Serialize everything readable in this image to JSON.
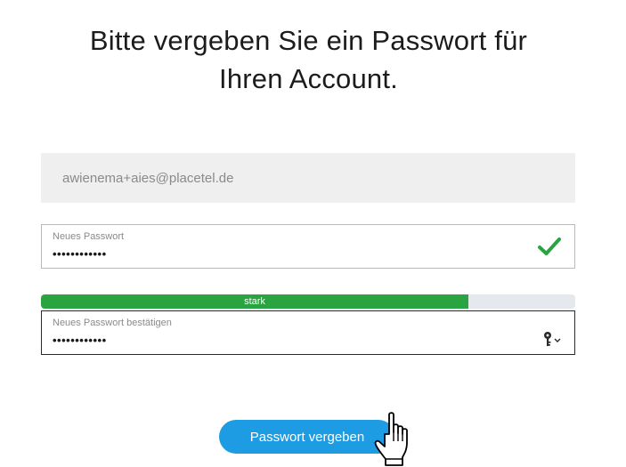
{
  "heading": {
    "line1": "Bitte vergeben Sie ein Passwort für",
    "line2": "Ihren Account."
  },
  "email": {
    "value": "awienema+aies@placetel.de"
  },
  "new_password": {
    "label": "Neues Passwort",
    "value": "••••••••••••",
    "status_icon": "checkmark-icon",
    "status_color": "#2aa440"
  },
  "strength": {
    "label": "stark",
    "level": 0.8,
    "color": "#2aa440"
  },
  "confirm_password": {
    "label": "Neues Passwort bestätigen",
    "value": "••••••••••••",
    "icon": "key-icon"
  },
  "submit": {
    "label": "Passwort vergeben",
    "color": "#1e9ce3"
  }
}
